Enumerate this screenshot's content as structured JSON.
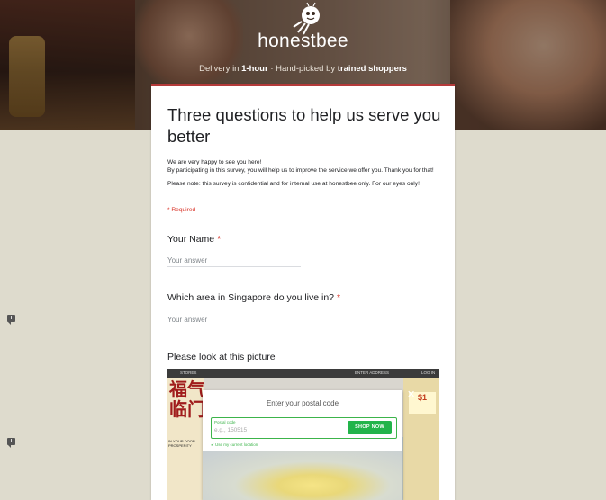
{
  "header": {
    "brand": "honestbee",
    "tagline_part1": "Delivery in ",
    "tagline_bold1": "1-hour",
    "tagline_part2": " · Hand-picked by ",
    "tagline_bold2": "trained shoppers"
  },
  "form": {
    "title": "Three questions to help us serve you better",
    "description_line1": "We are very happy to see you here!",
    "description_line2": "By participating in this survey, you will help us to improve the service we offer you. Thank you for that!",
    "description_note": "Please note: this survey is confidential and for internal use at honestbee only. For our eyes only!",
    "required_note": "* Required",
    "questions": [
      {
        "label": "Your Name",
        "required_mark": "*",
        "placeholder": "Your answer"
      },
      {
        "label": "Which area in Singapore do you live in?",
        "required_mark": "*",
        "placeholder": "Your answer"
      },
      {
        "label": "Please look at this picture"
      }
    ]
  },
  "picture": {
    "topbar_left": "STORES",
    "topbar_right1": "ENTER ADDRESS",
    "topbar_right2": "LOG IN",
    "chinese_text": "福气\n临门",
    "left_caption": "IN YOUR DOOR\nPROSPERITY",
    "price": "$1",
    "modal_title": "Enter your postal code",
    "postal_label": "Postal code",
    "postal_placeholder": "e.g., 150515",
    "shop_button": "SHOP NOW",
    "location_link": "Use my current location"
  },
  "colors": {
    "accent": "#b43a3a",
    "required": "#d93025",
    "page_bg": "#dedbcd",
    "shop_green": "#22b44a"
  }
}
